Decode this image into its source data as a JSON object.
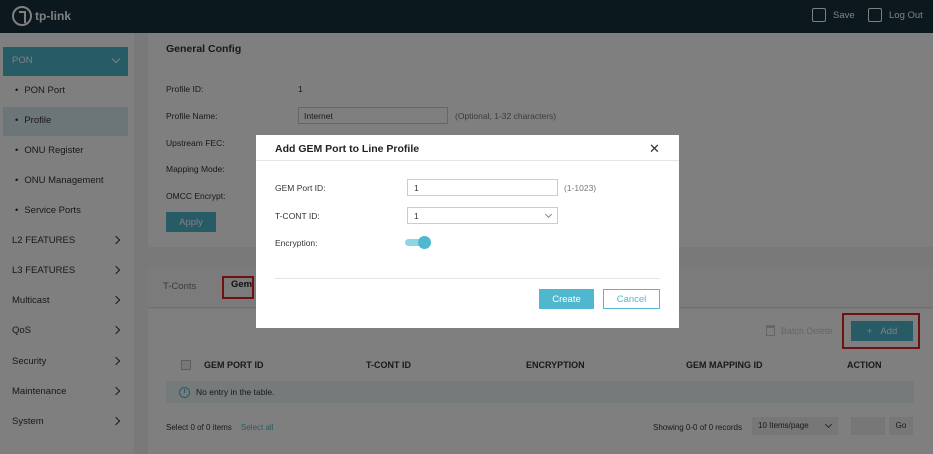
{
  "header": {
    "brand": "tp-link",
    "save_label": "Save",
    "logout_label": "Log Out"
  },
  "sidebar": {
    "pon": "PON",
    "pon_items": [
      "PON Port",
      "Profile",
      "ONU Register",
      "ONU Management",
      "Service Ports"
    ],
    "items": [
      "L2 FEATURES",
      "L3 FEATURES",
      "Multicast",
      "QoS",
      "Security",
      "Maintenance",
      "System"
    ]
  },
  "config": {
    "title": "General Config",
    "profile_id_label": "Profile ID:",
    "profile_id_value": "1",
    "profile_name_label": "Profile Name:",
    "profile_name_value": "Internet",
    "profile_name_hint": "(Optional, 1-32 characters)",
    "upstream_fec_label": "Upstream FEC:",
    "mapping_mode_label": "Mapping Mode:",
    "omcc_encrypt_label": "OMCC Encrypt:",
    "apply_label": "Apply"
  },
  "tabs": {
    "tcont": "T-Conts",
    "gem": "Gem"
  },
  "table": {
    "batch_delete": "Batch Delete",
    "add_label": "Add",
    "columns": [
      "GEM PORT ID",
      "T-CONT ID",
      "ENCRYPTION",
      "GEM MAPPING ID",
      "ACTION"
    ],
    "empty": "No entry in the table.",
    "selected": "Select 0 of 0 items",
    "select_all": "Select all",
    "showing": "Showing 0-0 of 0 records",
    "per_page": "10 Items/page",
    "go": "Go"
  },
  "modal": {
    "title": "Add GEM Port to Line Profile",
    "gem_port_label": "GEM Port ID:",
    "gem_port_value": "1",
    "gem_port_hint": "(1-1023)",
    "tcont_label": "T-CONT ID:",
    "tcont_value": "1",
    "encryption_label": "Encryption:",
    "encryption_on": true,
    "create_label": "Create",
    "cancel_label": "Cancel"
  },
  "colors": {
    "accent": "#4fb8cf",
    "topbar": "#16323f",
    "highlight": "#e02020"
  }
}
